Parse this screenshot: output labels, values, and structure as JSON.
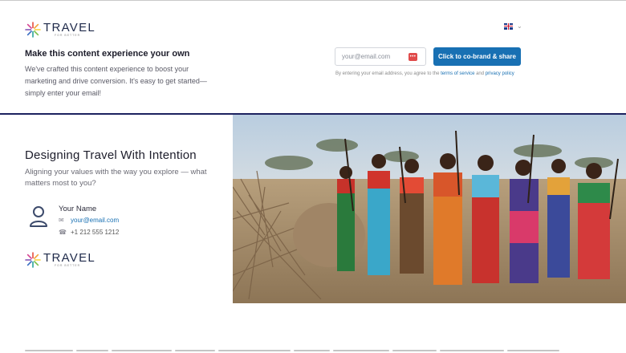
{
  "brand": {
    "name": "TRAVEL",
    "tagline": "FOR BETTER"
  },
  "language": {
    "flag": "uk-flag-icon",
    "chevron": "⌄"
  },
  "cobrand": {
    "title": "Make this content experience your own",
    "description": "We've crafted this content experience to boost your marketing and drive conversion. It's easy to get started—simply enter your email!",
    "email_placeholder": "your@email.com",
    "button_label": "Click to co-brand & share",
    "terms_prefix": "By entering your email address, you agree to the ",
    "terms_link": "terms of service",
    "terms_mid": " and ",
    "privacy_link": "privacy policy"
  },
  "card": {
    "title": "Designing Travel With Intention",
    "subtitle": "Aligning your values with the way you explore — what matters most to you?",
    "contact": {
      "name": "Your Name",
      "email": "your@email.com",
      "phone": "+1 212 555 1212"
    }
  },
  "colors": {
    "accent": "#1870b3",
    "divider": "#1c2260",
    "key_icon": "#e04a4a"
  }
}
